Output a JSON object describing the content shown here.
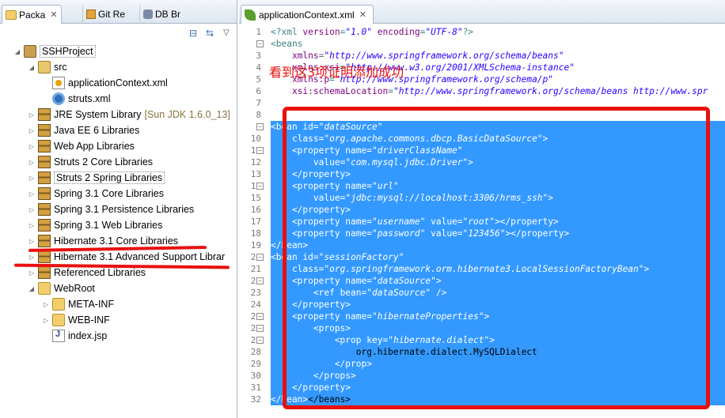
{
  "left_panel": {
    "tabs": [
      {
        "label": "Packa",
        "close": "✕"
      },
      {
        "label": "Git Re"
      },
      {
        "label": "DB Br"
      }
    ],
    "tree": [
      {
        "label": "SSHProject"
      },
      {
        "label": "src"
      },
      {
        "label": "applicationContext.xml"
      },
      {
        "label": "struts.xml"
      },
      {
        "label": "JRE System Library",
        "extra": "[Sun JDK 1.6.0_13]"
      },
      {
        "label": "Java EE 6 Libraries"
      },
      {
        "label": "Web App Libraries"
      },
      {
        "label": "Struts 2 Core Libraries"
      },
      {
        "label": "Struts 2 Spring Libraries"
      },
      {
        "label": "Spring 3.1 Core Libraries"
      },
      {
        "label": "Spring 3.1 Persistence Libraries"
      },
      {
        "label": "Spring 3.1 Web Libraries"
      },
      {
        "label": "Hibernate 3.1 Core Libraries"
      },
      {
        "label": "Hibernate 3.1 Advanced Support Librar"
      },
      {
        "label": "Referenced Libraries"
      },
      {
        "label": "WebRoot"
      },
      {
        "label": "META-INF"
      },
      {
        "label": "WEB-INF"
      },
      {
        "label": "index.jsp"
      }
    ]
  },
  "editor": {
    "tab_label": "applicationContext.xml",
    "annotation": "看到这3项证明添加成功",
    "line_numbers": [
      "1",
      "2",
      "3",
      "4",
      "5",
      "6",
      "7",
      "8",
      "9",
      "10",
      "11",
      "12",
      "13",
      "14",
      "15",
      "16",
      "17",
      "18",
      "19",
      "20",
      "21",
      "22",
      "23",
      "24",
      "25",
      "26",
      "27",
      "28",
      "29",
      "30",
      "31",
      "32"
    ],
    "lines": [
      [
        [
          "t",
          "<?xml "
        ],
        [
          "a",
          "version"
        ],
        [
          "t",
          "="
        ],
        [
          "v",
          "\"1.0\""
        ],
        [
          "t",
          " "
        ],
        [
          "a",
          "encoding"
        ],
        [
          "t",
          "="
        ],
        [
          "v",
          "\"UTF-8\""
        ],
        [
          "t",
          "?>"
        ]
      ],
      [
        [
          "t",
          "<beans"
        ]
      ],
      [
        [
          "t",
          "    "
        ],
        [
          "a",
          "xmlns"
        ],
        [
          "t",
          "="
        ],
        [
          "v",
          "\"http://www.springframework.org/schema/beans\""
        ]
      ],
      [
        [
          "t",
          "    "
        ],
        [
          "a",
          "xmlns:xsi"
        ],
        [
          "t",
          "="
        ],
        [
          "v",
          "\"http://www.w3.org/2001/XMLSchema-instance\""
        ]
      ],
      [
        [
          "t",
          "    "
        ],
        [
          "a",
          "xmlns:p"
        ],
        [
          "t",
          "="
        ],
        [
          "v",
          "\"http://www.springframework.org/schema/p\""
        ]
      ],
      [
        [
          "t",
          "    "
        ],
        [
          "a",
          "xsi:schemaLocation"
        ],
        [
          "t",
          "="
        ],
        [
          "v",
          "\"http://www.springframework.org/schema/beans http://www.spr"
        ]
      ],
      [],
      [],
      [
        [
          "t",
          "<bean "
        ],
        [
          "a",
          "id"
        ],
        [
          "t",
          "="
        ],
        [
          "v",
          "\"dataSource\""
        ]
      ],
      [
        [
          "t",
          "    "
        ],
        [
          "a",
          "class"
        ],
        [
          "t",
          "="
        ],
        [
          "v",
          "\"org.apache.commons.dbcp.BasicDataSource\""
        ],
        [
          "t",
          ">"
        ]
      ],
      [
        [
          "t",
          "    <property "
        ],
        [
          "a",
          "name"
        ],
        [
          "t",
          "="
        ],
        [
          "v",
          "\"driverClassName\""
        ]
      ],
      [
        [
          "t",
          "        "
        ],
        [
          "a",
          "value"
        ],
        [
          "t",
          "="
        ],
        [
          "v",
          "\"com.mysql.jdbc.Driver\""
        ],
        [
          "t",
          ">"
        ]
      ],
      [
        [
          "t",
          "    </property>"
        ]
      ],
      [
        [
          "t",
          "    <property "
        ],
        [
          "a",
          "name"
        ],
        [
          "t",
          "="
        ],
        [
          "v",
          "\"url\""
        ]
      ],
      [
        [
          "t",
          "        "
        ],
        [
          "a",
          "value"
        ],
        [
          "t",
          "="
        ],
        [
          "v",
          "\"jdbc:mysql://localhost:3306/hrms_ssh\""
        ],
        [
          "t",
          ">"
        ]
      ],
      [
        [
          "t",
          "    </property>"
        ]
      ],
      [
        [
          "t",
          "    <property "
        ],
        [
          "a",
          "name"
        ],
        [
          "t",
          "="
        ],
        [
          "v",
          "\"username\""
        ],
        [
          "t",
          " "
        ],
        [
          "a",
          "value"
        ],
        [
          "t",
          "="
        ],
        [
          "v",
          "\"root\""
        ],
        [
          "t",
          "></property>"
        ]
      ],
      [
        [
          "t",
          "    <property "
        ],
        [
          "a",
          "name"
        ],
        [
          "t",
          "="
        ],
        [
          "v",
          "\"password\""
        ],
        [
          "t",
          " "
        ],
        [
          "a",
          "value"
        ],
        [
          "t",
          "="
        ],
        [
          "v",
          "\"123456\""
        ],
        [
          "t",
          "></property>"
        ]
      ],
      [
        [
          "t",
          "</bean>"
        ]
      ],
      [
        [
          "t",
          "<bean "
        ],
        [
          "a",
          "id"
        ],
        [
          "t",
          "="
        ],
        [
          "v",
          "\"sessionFactory\""
        ]
      ],
      [
        [
          "t",
          "    "
        ],
        [
          "a",
          "class"
        ],
        [
          "t",
          "="
        ],
        [
          "v",
          "\"org.springframework.orm.hibernate3.LocalSessionFactoryBean\""
        ],
        [
          "t",
          ">"
        ]
      ],
      [
        [
          "t",
          "    <property "
        ],
        [
          "a",
          "name"
        ],
        [
          "t",
          "="
        ],
        [
          "v",
          "\"dataSource\""
        ],
        [
          "t",
          ">"
        ]
      ],
      [
        [
          "t",
          "        <ref "
        ],
        [
          "a",
          "bean"
        ],
        [
          "t",
          "="
        ],
        [
          "v",
          "\"dataSource\""
        ],
        [
          "t",
          " />"
        ]
      ],
      [
        [
          "t",
          "    </property>"
        ]
      ],
      [
        [
          "t",
          "    <property "
        ],
        [
          "a",
          "name"
        ],
        [
          "t",
          "="
        ],
        [
          "v",
          "\"hibernateProperties\""
        ],
        [
          "t",
          ">"
        ]
      ],
      [
        [
          "t",
          "        <props>"
        ]
      ],
      [
        [
          "t",
          "            <prop "
        ],
        [
          "a",
          "key"
        ],
        [
          "t",
          "="
        ],
        [
          "v",
          "\"hibernate.dialect\""
        ],
        [
          "t",
          ">"
        ]
      ],
      [
        [
          "tn",
          "                org.hibernate.dialect.MySQLDialect"
        ]
      ],
      [
        [
          "t",
          "            </prop>"
        ]
      ],
      [
        [
          "t",
          "        </props>"
        ]
      ],
      [
        [
          "t",
          "    </property>"
        ]
      ],
      [
        [
          "t",
          "</bean>"
        ],
        [
          "tn",
          "</beans>"
        ]
      ]
    ]
  },
  "colors": {
    "selection": "#3399ff",
    "annotation_red": "#e8100e",
    "xml_tag": "#3f7f7f",
    "xml_attr": "#7f007f",
    "xml_value": "#2a00ff"
  }
}
